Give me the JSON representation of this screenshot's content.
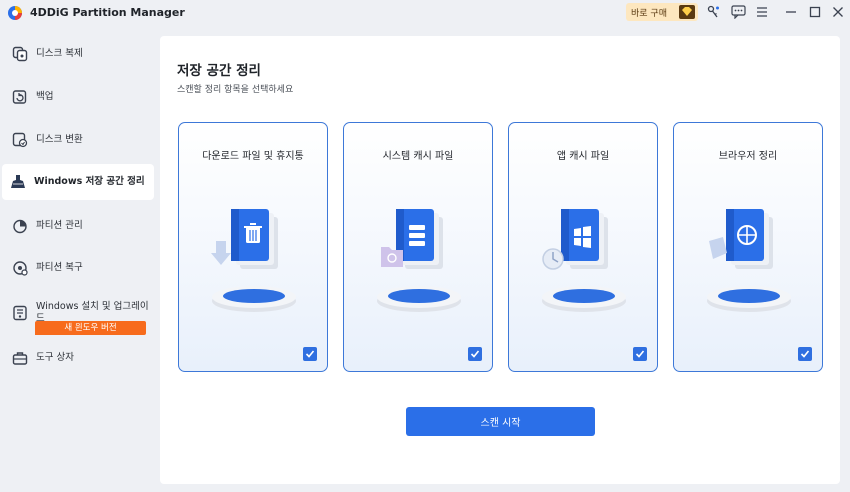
{
  "app": {
    "title": "4DDiG Partition Manager",
    "buy_label": "바로 구매"
  },
  "titlebar": {
    "icons": [
      "key-icon",
      "feedback-icon",
      "menu-icon",
      "minimize-icon",
      "maximize-icon",
      "close-icon"
    ]
  },
  "sidebar": {
    "items": [
      {
        "label": "디스크 복제",
        "icon": "clone-icon"
      },
      {
        "label": "백업",
        "icon": "backup-icon"
      },
      {
        "label": "디스크 변환",
        "icon": "convert-icon"
      },
      {
        "label": "Windows 저장 공간 정리",
        "icon": "broom-icon",
        "active": true
      },
      {
        "label": "파티션 관리",
        "icon": "pie-chart-icon"
      },
      {
        "label": "파티션 복구",
        "icon": "recovery-icon"
      },
      {
        "label": "Windows 설치 및 업그레이드",
        "icon": "install-icon"
      },
      {
        "label": "도구 상자",
        "icon": "toolbox-icon"
      }
    ],
    "new_badge": "새 윈도우 버전"
  },
  "main": {
    "title": "저장 공간 정리",
    "subtitle": "스캔할 정리 항목을 선택하세요",
    "cards": [
      {
        "label": "다운로드 파일 및 휴지통",
        "icon": "trash-download-icon",
        "checked": true
      },
      {
        "label": "시스템 캐시 파일",
        "icon": "system-cache-icon",
        "checked": true
      },
      {
        "label": "앱 캐시 파일",
        "icon": "app-cache-icon",
        "checked": true
      },
      {
        "label": "브라우저 정리",
        "icon": "browser-icon",
        "checked": true
      }
    ],
    "scan_button": "스캔 시작"
  },
  "colors": {
    "accent": "#2b6fe8",
    "card_border": "#3d78d8",
    "badge": "#f76b1c",
    "buy_bg": "#fde7bf"
  }
}
